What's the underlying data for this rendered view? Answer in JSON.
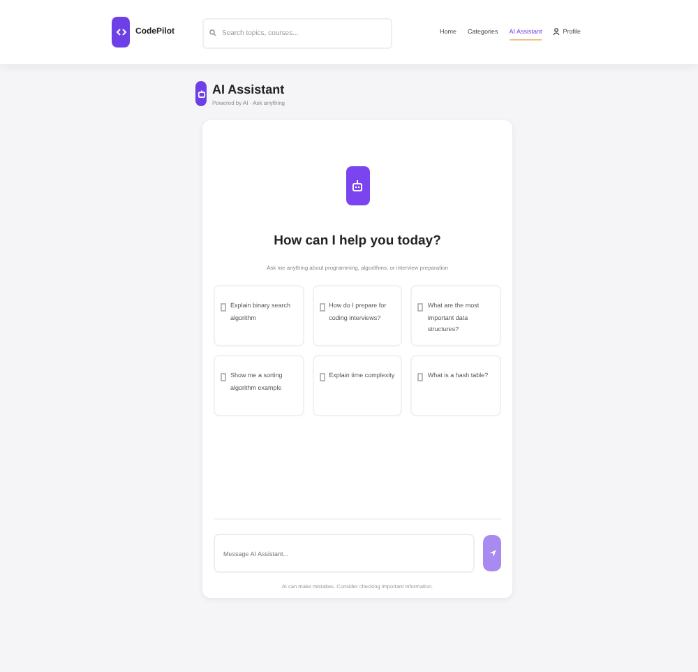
{
  "brand": {
    "name": "CodePilot"
  },
  "search": {
    "placeholder": "Search topics, courses..."
  },
  "nav": [
    {
      "label": "Home",
      "selected": false,
      "kind": "link"
    },
    {
      "label": "Categories",
      "selected": false,
      "kind": "link"
    },
    {
      "label": "AI Assistant",
      "selected": true,
      "kind": "link"
    },
    {
      "label": "Profile",
      "selected": false,
      "kind": "profile"
    }
  ],
  "header": {
    "title": "AI Assistant",
    "subtitle": "Powered by AI · Ask anything"
  },
  "welcome": {
    "heading": "How can I help you today?",
    "text": "Ask me anything about programming, algorithms, or interview preparation"
  },
  "suggestions": [
    "Explain binary search algorithm",
    "How do I prepare for coding interviews?",
    "What are the most important data structures?",
    "Show me a sorting algorithm example",
    "Explain time complexity",
    "What is a hash table?"
  ],
  "composer": {
    "placeholder": "Message AI Assistant..."
  },
  "disclaimer": "AI can make mistakes. Consider checking important information."
}
